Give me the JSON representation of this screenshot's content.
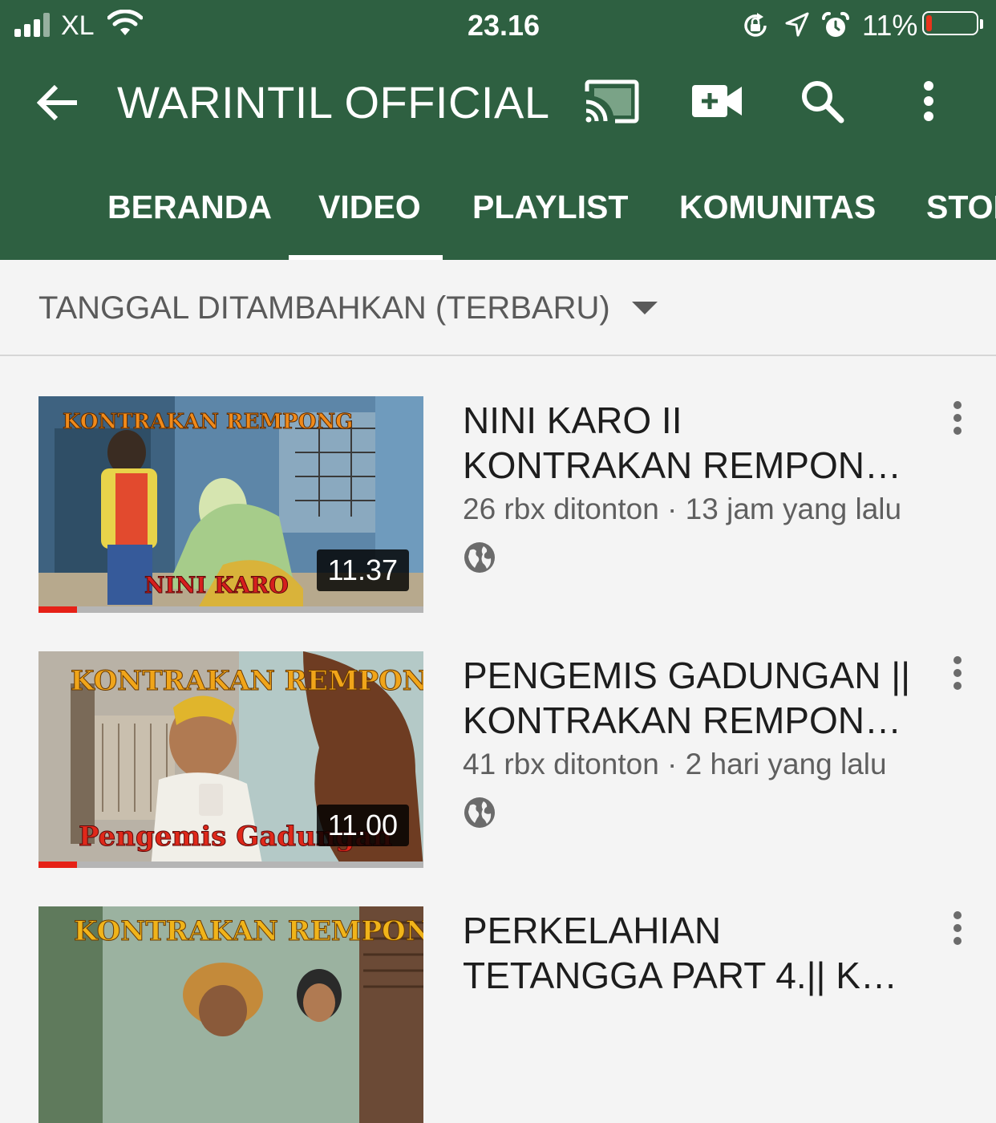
{
  "status_bar": {
    "carrier": "XL",
    "time": "23.16",
    "battery_percent": "11%",
    "battery_level": 0.11,
    "icons": [
      "signal-icon",
      "wifi-icon",
      "rotation-lock-icon",
      "location-icon",
      "alarm-icon",
      "battery-icon"
    ]
  },
  "app_bar": {
    "back_icon": "arrow-left-icon",
    "title": "WARINTIL OFFICIAL",
    "actions": [
      "cast-icon",
      "video-camera-add-icon",
      "search-icon",
      "more-vert-icon"
    ]
  },
  "tabs": [
    {
      "label": "BERANDA",
      "active": false
    },
    {
      "label": "VIDEO",
      "active": true
    },
    {
      "label": "PLAYLIST",
      "active": false
    },
    {
      "label": "KOMUNITAS",
      "active": false
    },
    {
      "label": "STORE",
      "active": false
    }
  ],
  "sort": {
    "label": "TANGGAL DITAMBAHKAN (TERBARU)",
    "icon": "caret-down-icon"
  },
  "videos": [
    {
      "title_line1": "NINI KARO II",
      "title_line2": "KONTRAKAN REMPONG...",
      "meta": "26 rbx ditonton · 13 jam yang lalu",
      "duration": "11.37",
      "watched_fraction": 0.1,
      "thumb_text_top": "KONTRAKAN REMPONG",
      "thumb_text_bottom": "NINI KARO",
      "visibility_icon": "globe-icon"
    },
    {
      "title_line1": "PENGEMIS GADUNGAN ||",
      "title_line2": "KONTRAKAN REMPONG...",
      "meta": "41 rbx ditonton · 2 hari yang lalu",
      "duration": "11.00",
      "watched_fraction": 0.1,
      "thumb_text_top": "KONTRAKAN REMPONG",
      "thumb_text_bottom": "Pengemis Gadungan",
      "visibility_icon": "globe-icon"
    },
    {
      "title_line1": "PERKELAHIAN",
      "title_line2": "TETANGGA PART 4.|| KO...",
      "thumb_text_top": "KONTRAKAN REMPONG"
    }
  ],
  "colors": {
    "header_bg": "#2e6041",
    "content_bg": "#f4f4f4",
    "progress_red": "#e62117",
    "battery_low": "#e8341c"
  }
}
